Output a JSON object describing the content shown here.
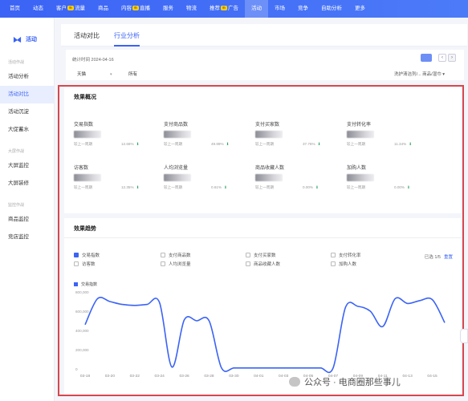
{
  "topnav": {
    "items": [
      {
        "label": "首页"
      },
      {
        "label": "动态"
      },
      {
        "label": "客户",
        "tag": "新",
        "suffix": "流量"
      },
      {
        "label": "商品"
      },
      {
        "label": "内容",
        "tag": "新",
        "suffix": "直播"
      },
      {
        "label": "服务"
      },
      {
        "label": "物流"
      },
      {
        "label": "推荐",
        "tag": "新",
        "suffix": "广告"
      },
      {
        "label": "活动",
        "active": true
      },
      {
        "label": "市场"
      },
      {
        "label": "竞争"
      },
      {
        "label": "自助分析"
      },
      {
        "label": "更多"
      }
    ]
  },
  "sidebar": {
    "brand": "活动",
    "groups": [
      {
        "title": "活动作战",
        "items": [
          {
            "label": "活动分析"
          },
          {
            "label": "活动对比",
            "active": true
          },
          {
            "label": "活动沉淀"
          },
          {
            "label": "大促蓄水"
          }
        ]
      },
      {
        "title": "大屏作战",
        "items": [
          {
            "label": "大屏监控"
          },
          {
            "label": "大屏装修"
          }
        ]
      },
      {
        "title": "监控作战",
        "items": [
          {
            "label": "商品监控"
          },
          {
            "label": "竞店监控"
          }
        ]
      }
    ]
  },
  "tabs": [
    {
      "label": "活动对比"
    },
    {
      "label": "行业分析",
      "active": true
    }
  ],
  "filters": {
    "date_text": "统计时间 2024-04-16",
    "shop_select": "天猫",
    "scope_select": "所有",
    "right_select": "洗护清洁剂/...   商品/湿巾"
  },
  "overview": {
    "title": "效果概况",
    "metrics": [
      {
        "label": "交易指数",
        "compare_label": "较上一周期",
        "change": "12.66%"
      },
      {
        "label": "支付商品数",
        "compare_label": "较上一周期",
        "change": "49.89%"
      },
      {
        "label": "支付买家数",
        "compare_label": "较上一周期",
        "change": "37.76%"
      },
      {
        "label": "支付转化率",
        "compare_label": "较上一周期",
        "change": "11.34%"
      },
      {
        "label": "访客数",
        "compare_label": "较上一周期",
        "change": "12.35%"
      },
      {
        "label": "人均浏览量",
        "compare_label": "较上一周期",
        "change": "0.61%"
      },
      {
        "label": "商品收藏人数",
        "compare_label": "较上一周期",
        "change": "0.00%"
      },
      {
        "label": "加购人数",
        "compare_label": "较上一周期",
        "change": "0.00%"
      }
    ],
    "up_arrow": "⬇"
  },
  "trend": {
    "title": "效果趋势",
    "legend": [
      {
        "label": "交易指数",
        "checked": true
      },
      {
        "label": "支付商品数",
        "checked": false
      },
      {
        "label": "支付买家数",
        "checked": false
      },
      {
        "label": "支付转化率",
        "checked": false
      },
      {
        "label": "访客数",
        "checked": false
      },
      {
        "label": "人均浏览量",
        "checked": false
      },
      {
        "label": "商品收藏人数",
        "checked": false
      },
      {
        "label": "加购人数",
        "checked": false
      }
    ],
    "selected_count": "已选 1/5",
    "reset_label": "重置",
    "accent_color": "#3b63f5"
  },
  "chart_data": {
    "type": "line",
    "x": [
      "03-18",
      "03-19",
      "03-20",
      "03-21",
      "03-22",
      "03-23",
      "03-24",
      "03-25",
      "03-26",
      "03-27",
      "03-28",
      "03-29",
      "03-30",
      "03-31",
      "04-01",
      "04-02",
      "04-03",
      "04-04",
      "04-05",
      "04-06",
      "04-07",
      "04-08",
      "04-09",
      "04-10",
      "04-11",
      "04-12",
      "04-13",
      "04-14",
      "04-15",
      "04-16"
    ],
    "tick_labels": [
      "03-18",
      "03-20",
      "03-22",
      "03-24",
      "03-26",
      "03-28",
      "03-30",
      "04-01",
      "04-03",
      "04-05",
      "04-07",
      "04-09",
      "04-11",
      "04-13",
      "04-15"
    ],
    "series": [
      {
        "name": "交易指数",
        "values": [
          460000,
          730000,
          700000,
          670000,
          660000,
          670000,
          690000,
          20000,
          510000,
          500000,
          500000,
          10000,
          10000,
          10000,
          10000,
          10000,
          10000,
          10000,
          10000,
          10000,
          10000,
          640000,
          650000,
          600000,
          440000,
          730000,
          680000,
          710000,
          720000,
          480000
        ]
      }
    ],
    "yticks": [
      "0",
      "200,000",
      "400,000",
      "600,000",
      "800,000"
    ],
    "ylim": [
      0,
      800000
    ],
    "grid": false,
    "title": "",
    "xlabel": "",
    "ylabel": ""
  },
  "watermark": "公众号 · 电商圈那些事儿"
}
